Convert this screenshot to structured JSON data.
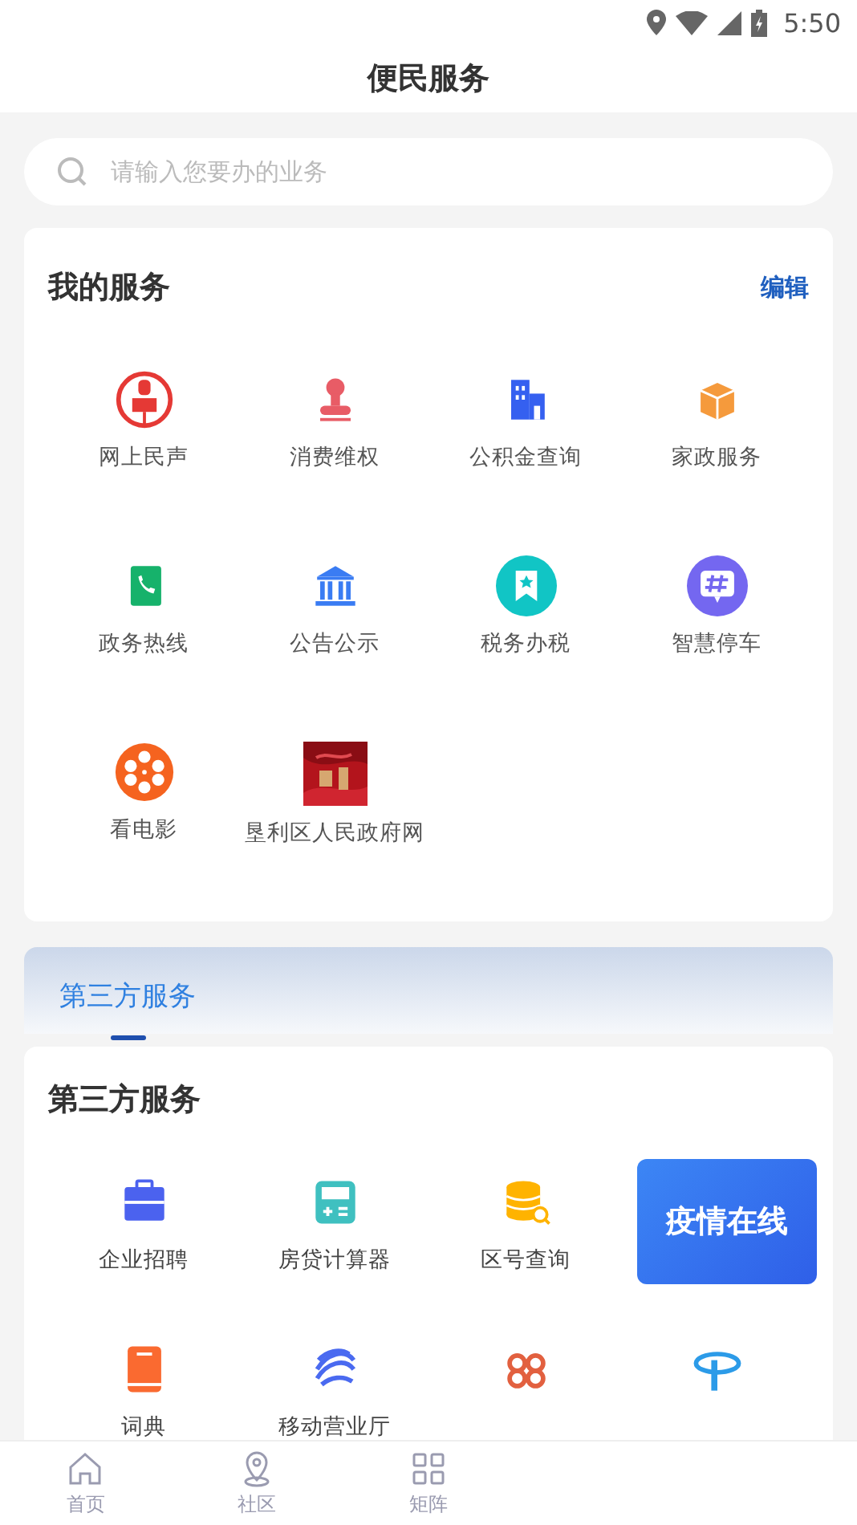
{
  "status_bar": {
    "time": "5:50"
  },
  "header": {
    "title": "便民服务"
  },
  "search": {
    "placeholder": "请输入您要办的业务"
  },
  "my_services": {
    "title": "我的服务",
    "action": "编辑",
    "items": [
      {
        "label": "网上民声"
      },
      {
        "label": "消费维权"
      },
      {
        "label": "公积金查询"
      },
      {
        "label": "家政服务"
      },
      {
        "label": "政务热线"
      },
      {
        "label": "公告公示"
      },
      {
        "label": "税务办税"
      },
      {
        "label": "智慧停车"
      },
      {
        "label": "看电影"
      },
      {
        "label": "垦利区人民政府网",
        "kind": "picture"
      }
    ]
  },
  "tabs": [
    {
      "label": "第三方服务",
      "selected": true
    }
  ],
  "third_party": {
    "title": "第三方服务",
    "items": [
      {
        "kind": "service",
        "label": "企业招聘"
      },
      {
        "kind": "service",
        "label": "房贷计算器"
      },
      {
        "kind": "service",
        "label": "区号查询"
      },
      {
        "kind": "banner",
        "label": "疫情在线"
      },
      {
        "kind": "service",
        "label": "词典"
      },
      {
        "kind": "service",
        "label": "移动营业厅"
      },
      {
        "kind": "icon"
      },
      {
        "kind": "icon"
      }
    ]
  },
  "bottom_nav": [
    {
      "label": "首页",
      "selected": false
    },
    {
      "label": "社区",
      "selected": false
    },
    {
      "label": "矩阵",
      "selected": false
    }
  ]
}
